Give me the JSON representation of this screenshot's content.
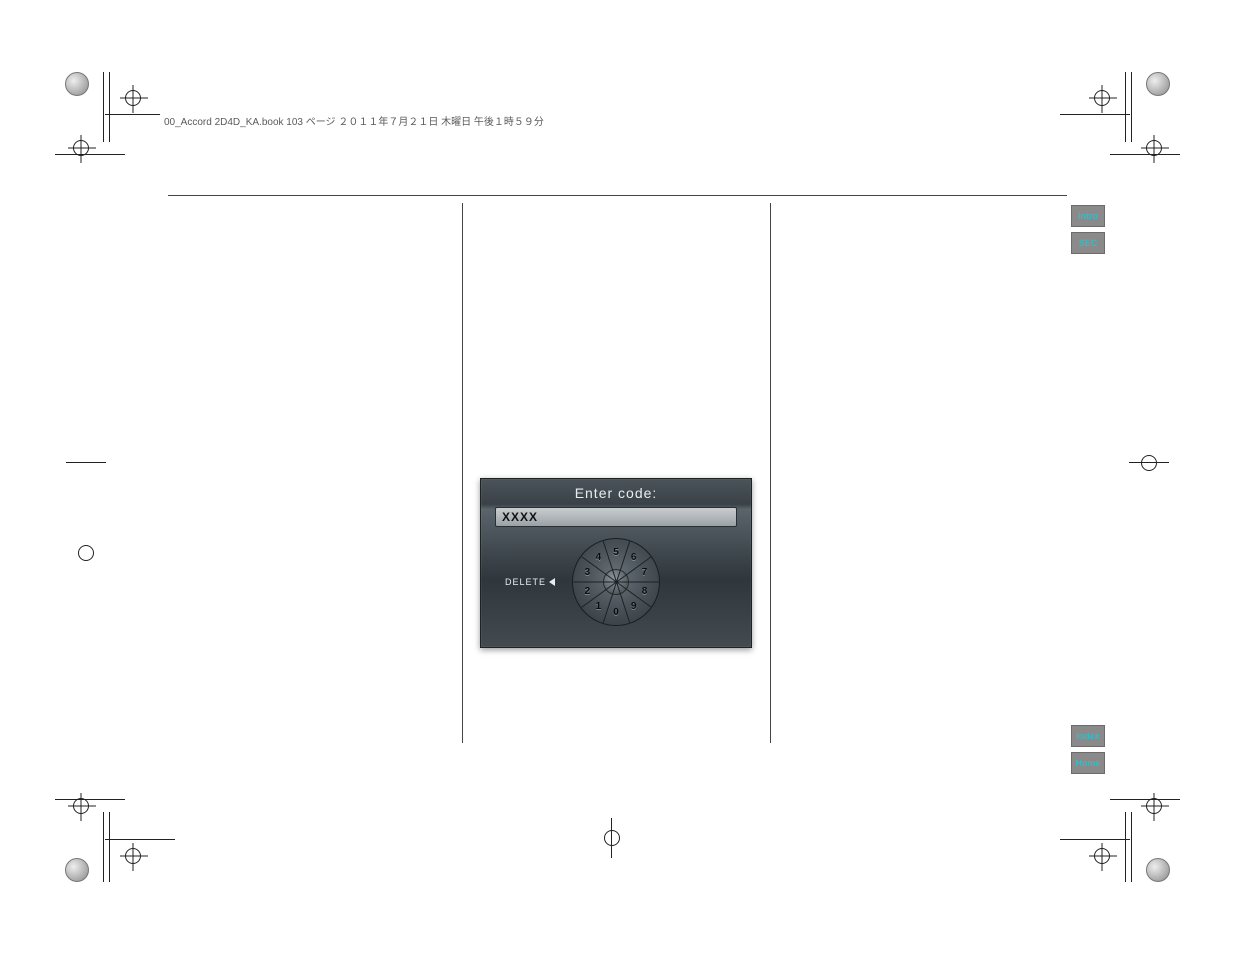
{
  "doc_header": "00_Accord 2D4D_KA.book  103 ページ  ２０１１年７月２１日  木曜日  午後１時５９分",
  "tabs": {
    "intro": "Intro",
    "sec": "SEC",
    "index": "Index",
    "home": "Home"
  },
  "navi": {
    "title": "Enter code:",
    "input_value": "XXXX",
    "delete_label": "DELETE",
    "digits": [
      "5",
      "6",
      "7",
      "8",
      "9",
      "0",
      "1",
      "2",
      "3",
      "4"
    ]
  }
}
